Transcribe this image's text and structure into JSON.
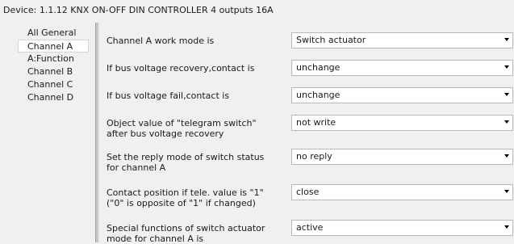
{
  "window": {
    "title": "Device: 1.1.12  KNX ON-OFF DIN CONTROLLER 4 outputs 16A"
  },
  "sidebar": {
    "items": [
      {
        "label": "All General",
        "selected": false
      },
      {
        "label": "Channel A",
        "selected": true
      },
      {
        "label": "A:Function",
        "selected": false
      },
      {
        "label": "Channel B",
        "selected": false
      },
      {
        "label": "Channel C",
        "selected": false
      },
      {
        "label": "Channel D",
        "selected": false
      }
    ]
  },
  "params": [
    {
      "label_line1": "Channel A work mode is",
      "label_line2": "",
      "value": "Switch actuator"
    },
    {
      "label_line1": "If bus voltage recovery,contact is",
      "label_line2": "",
      "value": "unchange"
    },
    {
      "label_line1": "If bus voltage fail,contact is",
      "label_line2": "",
      "value": "unchange"
    },
    {
      "label_line1": "Object value of \"telegram switch\"",
      "label_line2": "after bus voltage recovery",
      "value": "not write"
    },
    {
      "label_line1": "Set the reply mode of switch status",
      "label_line2": "for channel A",
      "value": "no reply"
    },
    {
      "label_line1": "Contact position if tele. value is \"1\"",
      "label_line2": " (\"0\" is opposite of \"1\" if changed)",
      "value": "close"
    },
    {
      "label_line1": "Special functions of switch actuator",
      "label_line2": " mode for channel A is",
      "value": "active"
    }
  ]
}
